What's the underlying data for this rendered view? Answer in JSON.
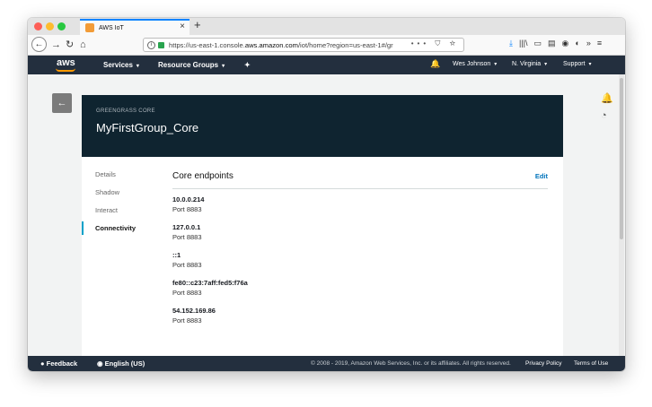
{
  "browser": {
    "tab_title": "AWS IoT",
    "tab_close": "×",
    "new_tab": "+",
    "url_prefix": "https://us-east-1.console.",
    "url_domain": "aws.amazon.com",
    "url_suffix": "/iot/home?region=us-east-1#/gr",
    "url_actions": "••• ⛉ ☆",
    "nav_back": "←",
    "nav_forward": "→",
    "nav_reload": "↻",
    "nav_home": "⌂",
    "toolbar_icons": [
      "⤓",
      "|||\\",
      "▭",
      "▤",
      "◉",
      "◐",
      "»",
      "≡"
    ]
  },
  "aws_header": {
    "logo": "aws",
    "services": "Services",
    "resource_groups": "Resource Groups",
    "pin": "✦",
    "bell": "🔔",
    "user": "Wes Johnson",
    "region": "N. Virginia",
    "support": "Support",
    "caret": "▾"
  },
  "page": {
    "back_arrow": "←",
    "bell_icon": "🔔",
    "pulse_icon": "◔",
    "subtitle": "GREENGRASS CORE",
    "title": "MyFirstGroup_Core",
    "nav": [
      {
        "label": "Details",
        "active": false
      },
      {
        "label": "Shadow",
        "active": false
      },
      {
        "label": "Interact",
        "active": false
      },
      {
        "label": "Connectivity",
        "active": true
      }
    ],
    "section_title": "Core endpoints",
    "edit_label": "Edit",
    "endpoints": [
      {
        "host": "10.0.0.214",
        "port": "Port 8883"
      },
      {
        "host": "127.0.0.1",
        "port": "Port 8883"
      },
      {
        "host": "::1",
        "port": "Port 8883"
      },
      {
        "host": "fe80::c23:7aff:fed5:f76a",
        "port": "Port 8883"
      },
      {
        "host": "54.152.169.86",
        "port": "Port 8883"
      }
    ]
  },
  "footer": {
    "feedback": "Feedback",
    "language": "English (US)",
    "copyright": "© 2008 - 2019, Amazon Web Services, Inc. or its affiliates. All rights reserved.",
    "privacy": "Privacy Policy",
    "terms": "Terms of Use"
  }
}
